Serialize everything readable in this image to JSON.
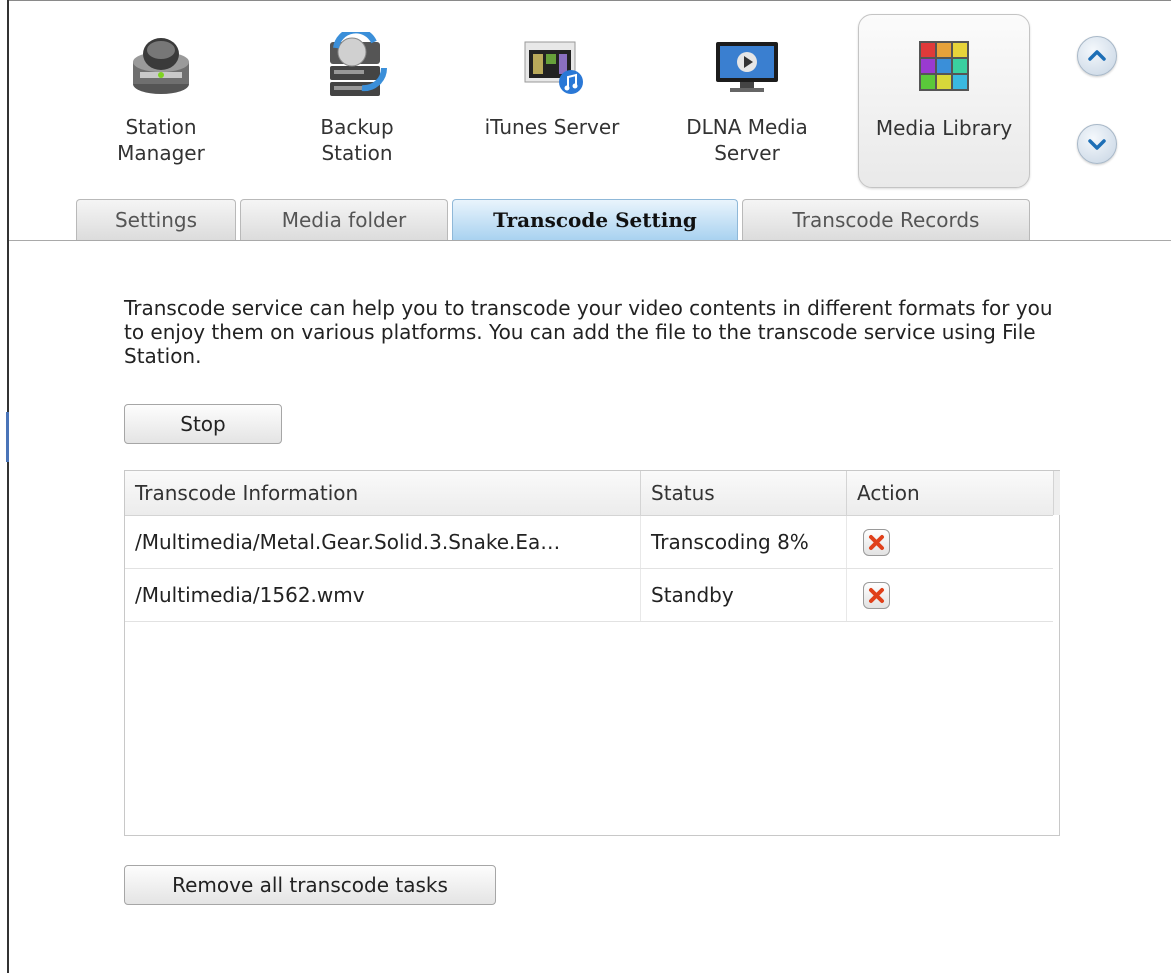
{
  "apps": [
    {
      "label": "Station\nManager",
      "icon": "station-manager-icon"
    },
    {
      "label": "Backup\nStation",
      "icon": "backup-station-icon"
    },
    {
      "label": "iTunes Server",
      "icon": "itunes-server-icon"
    },
    {
      "label": "DLNA Media\nServer",
      "icon": "dlna-media-server-icon"
    },
    {
      "label": "Media Library",
      "icon": "media-library-icon",
      "selected": true
    }
  ],
  "nav": {
    "up_icon": "chevron-up-icon",
    "down_icon": "chevron-down-icon"
  },
  "tabs": [
    {
      "label": "Settings"
    },
    {
      "label": "Media folder"
    },
    {
      "label": "Transcode Setting",
      "active": true
    },
    {
      "label": "Transcode Records"
    }
  ],
  "description": "Transcode service can help you to transcode your video contents in different formats for you to enjoy them on various platforms. You can add the file to the transcode service using File Station.",
  "stop_button": "Stop",
  "table": {
    "columns": [
      "Transcode Information",
      "Status",
      "Action"
    ],
    "rows": [
      {
        "info": "/Multimedia/Metal.Gear.Solid.3.Snake.Ea…",
        "status": "Transcoding 8%",
        "action_icon": "delete-icon"
      },
      {
        "info": "/Multimedia/1562.wmv",
        "status": "Standby",
        "action_icon": "delete-icon"
      }
    ]
  },
  "remove_all_button": "Remove all transcode tasks",
  "colors": {
    "active_tab": "#a9d2f0",
    "delete_x": "#e0401a",
    "nav_arrow": "#1e6fb6"
  }
}
